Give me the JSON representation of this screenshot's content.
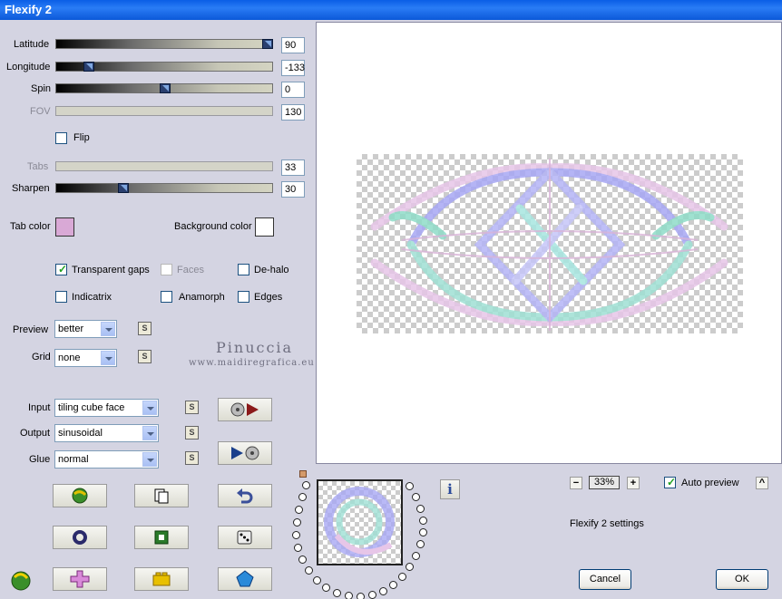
{
  "window": {
    "title": "Flexify 2"
  },
  "sliders": [
    {
      "label": "Latitude",
      "value": "90",
      "level": 0.97,
      "enabled": true
    },
    {
      "label": "Longitude",
      "value": "-133",
      "level": 0.15,
      "enabled": true
    },
    {
      "label": "Spin",
      "value": "0",
      "level": 0.5,
      "enabled": true
    },
    {
      "label": "FOV",
      "value": "130",
      "level": null,
      "enabled": false
    },
    {
      "label": "Tabs",
      "value": "33",
      "level": null,
      "enabled": false
    },
    {
      "label": "Sharpen",
      "value": "30",
      "level": 0.3,
      "enabled": true
    }
  ],
  "flip": {
    "label": "Flip",
    "checked": false
  },
  "colors": {
    "tab_color_label": "Tab color",
    "tab_color": "#d9a9d6",
    "background_color_label": "Background color",
    "background_color": "#ffffff"
  },
  "options": {
    "transparent_gaps": {
      "label": "Transparent gaps",
      "checked": true
    },
    "faces": {
      "label": "Faces",
      "checked": false
    },
    "de_halo": {
      "label": "De-halo",
      "checked": false
    },
    "indicatrix": {
      "label": "Indicatrix",
      "checked": false
    },
    "anamorph": {
      "label": "Anamorph",
      "checked": false
    },
    "edges": {
      "label": "Edges",
      "checked": false
    }
  },
  "preview_select": {
    "label": "Preview",
    "value": "better"
  },
  "grid_select": {
    "label": "Grid",
    "value": "none"
  },
  "s_label": "S",
  "watermark": {
    "line1": "Pinuccia",
    "line2": "www.maidiregrafica.eu"
  },
  "input_select": {
    "label": "Input",
    "value": "tiling cube face"
  },
  "output_select": {
    "label": "Output",
    "value": "sinusoidal"
  },
  "glue_select": {
    "label": "Glue",
    "value": "normal"
  },
  "zoom": {
    "minus": "−",
    "value": "33%",
    "plus": "+"
  },
  "auto_preview": {
    "label": "Auto preview",
    "checked": true,
    "up": "^"
  },
  "settings_name": "Flexify 2 settings",
  "info_label": "i",
  "buttons": {
    "cancel": "Cancel",
    "ok": "OK"
  }
}
